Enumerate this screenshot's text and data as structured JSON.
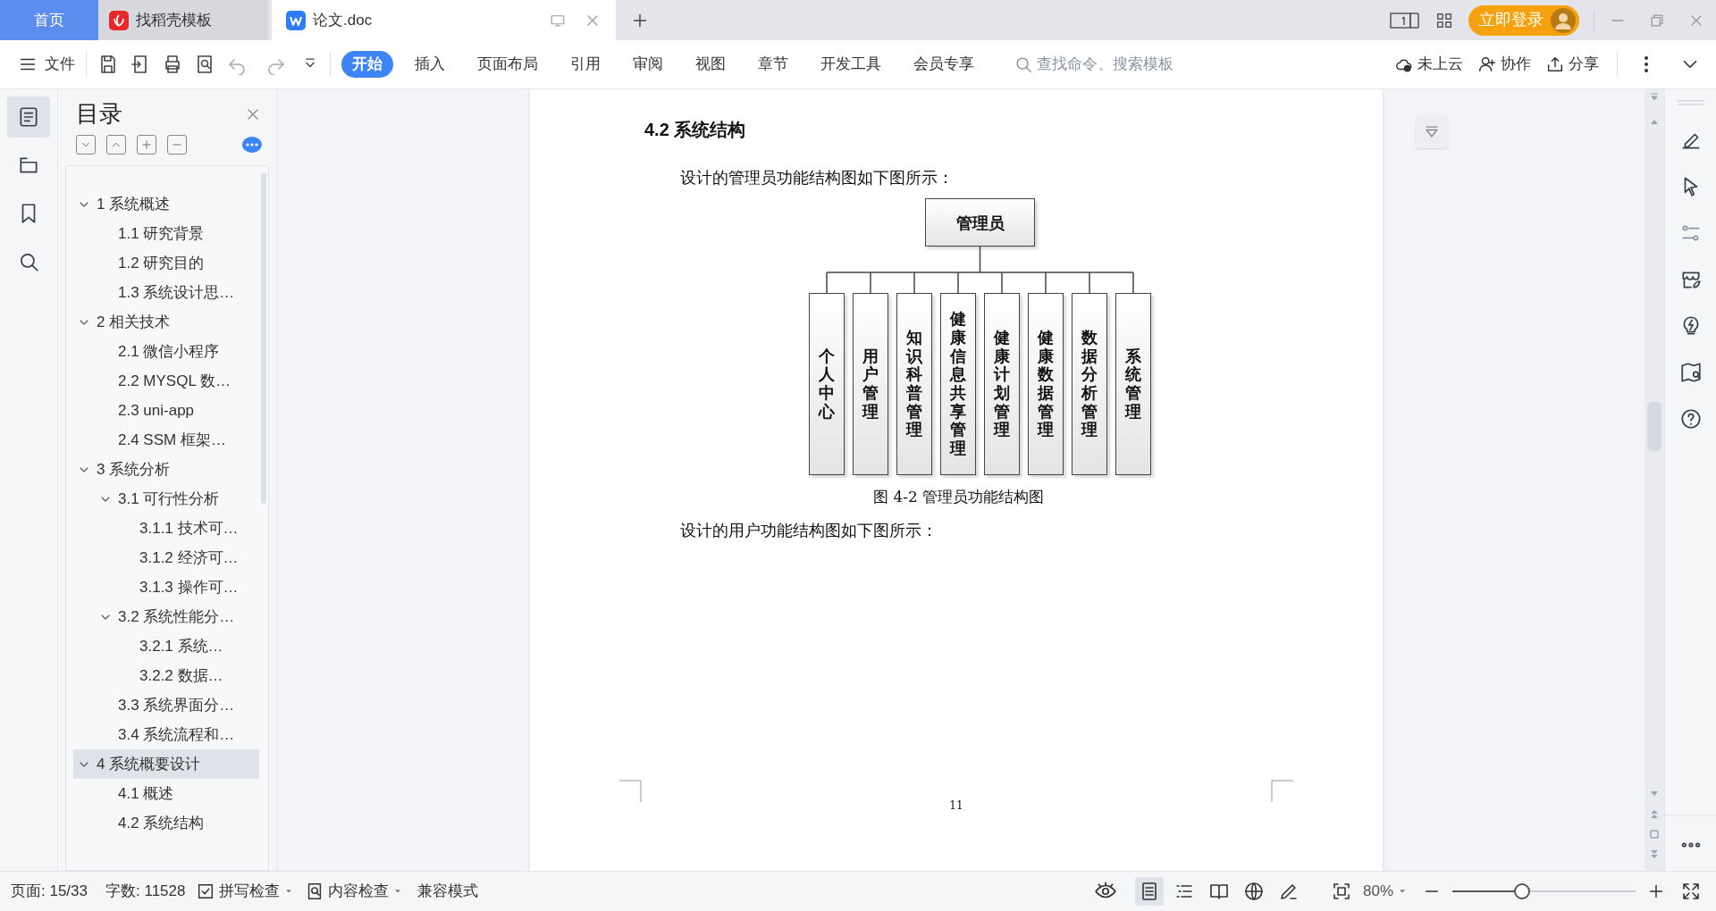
{
  "tabs": [
    {
      "label": "首页",
      "kind": "home",
      "selected": false
    },
    {
      "label": "找稻壳模板",
      "kind": "docer",
      "selected": false
    },
    {
      "label": "论文.doc",
      "kind": "doc",
      "selected": true
    }
  ],
  "login_button": "立即登录",
  "toolbar": {
    "file_menu": "文件",
    "ribbon_tabs": [
      {
        "label": "开始",
        "selected": true
      },
      {
        "label": "插入",
        "selected": false
      },
      {
        "label": "页面布局",
        "selected": false
      },
      {
        "label": "引用",
        "selected": false
      },
      {
        "label": "审阅",
        "selected": false
      },
      {
        "label": "视图",
        "selected": false
      },
      {
        "label": "章节",
        "selected": false
      },
      {
        "label": "开发工具",
        "selected": false
      },
      {
        "label": "会员专享",
        "selected": false
      }
    ],
    "search": {
      "placeholder": "查找命令、搜索模板"
    },
    "actions": [
      {
        "label": "未上云",
        "kind": "cloud"
      },
      {
        "label": "协作",
        "kind": "collab"
      },
      {
        "label": "分享",
        "kind": "share"
      }
    ]
  },
  "left_rail": [
    {
      "kind": "outline",
      "selected": true
    },
    {
      "kind": "chapters",
      "selected": false
    },
    {
      "kind": "bookmark",
      "selected": false
    },
    {
      "kind": "search",
      "selected": false
    }
  ],
  "outline": {
    "title": "目录",
    "items": [
      {
        "label": "1 系统概述",
        "expanded": true,
        "selected": false,
        "children": [
          {
            "label": "1.1  研究背景",
            "selected": false
          },
          {
            "label": "1.2 研究目的",
            "selected": false
          },
          {
            "label": "1.3 系统设计思…",
            "selected": false
          }
        ]
      },
      {
        "label": "2 相关技术",
        "expanded": true,
        "selected": false,
        "children": [
          {
            "label": "2.1 微信小程序",
            "selected": false
          },
          {
            "label": "2.2 MYSQL 数…",
            "selected": false
          },
          {
            "label": "2.3 uni-app",
            "selected": false
          },
          {
            "label": "2.4 SSM 框架…",
            "selected": false
          }
        ]
      },
      {
        "label": "3 系统分析",
        "expanded": true,
        "selected": false,
        "children": [
          {
            "label": "3.1 可行性分析",
            "expanded": true,
            "selected": false,
            "children": [
              {
                "label": "3.1.1 技术可…",
                "selected": false
              },
              {
                "label": "3.1.2 经济可…",
                "selected": false
              },
              {
                "label": "3.1.3 操作可…",
                "selected": false
              }
            ]
          },
          {
            "label": "3.2 系统性能分…",
            "expanded": true,
            "selected": false,
            "children": [
              {
                "label": "3.2.1  系统…",
                "selected": false
              },
              {
                "label": "3.2.2  数据…",
                "selected": false
              }
            ]
          },
          {
            "label": "3.3 系统界面分…",
            "selected": false
          },
          {
            "label": "3.4 系统流程和…",
            "selected": false
          }
        ]
      },
      {
        "label": "4 系统概要设计",
        "expanded": true,
        "selected": true,
        "children": [
          {
            "label": "4.1 概述",
            "selected": false
          },
          {
            "label": "4.2 系统结构",
            "selected": false
          }
        ]
      }
    ]
  },
  "document": {
    "heading": "4.2 系统结构",
    "intro": "设计的管理员功能结构图如下图所示：",
    "diagram": {
      "root": "管理员",
      "children": [
        "个人中心",
        "用户管理",
        "知识科普管理",
        "健康信息共享管理",
        "健康计划管理",
        "健康数据管理",
        "数据分析管理",
        "系统管理"
      ]
    },
    "caption": "图 4-2 管理员功能结构图",
    "next_paragraph": "设计的用户功能结构图如下图所示：",
    "page_number": "11"
  },
  "status_bar": {
    "page": "页面: 15/33",
    "words": "字数: 11528",
    "checks": [
      "拼写检查",
      "内容检查"
    ],
    "mode": "兼容模式",
    "view_modes": [
      {
        "kind": "page",
        "selected": true
      },
      {
        "kind": "outline",
        "selected": false
      },
      {
        "kind": "reading",
        "selected": false
      },
      {
        "kind": "web",
        "selected": false
      },
      {
        "kind": "write",
        "selected": false
      }
    ],
    "zoom": "80%",
    "zoom_slider": {
      "level": 0.38
    }
  }
}
